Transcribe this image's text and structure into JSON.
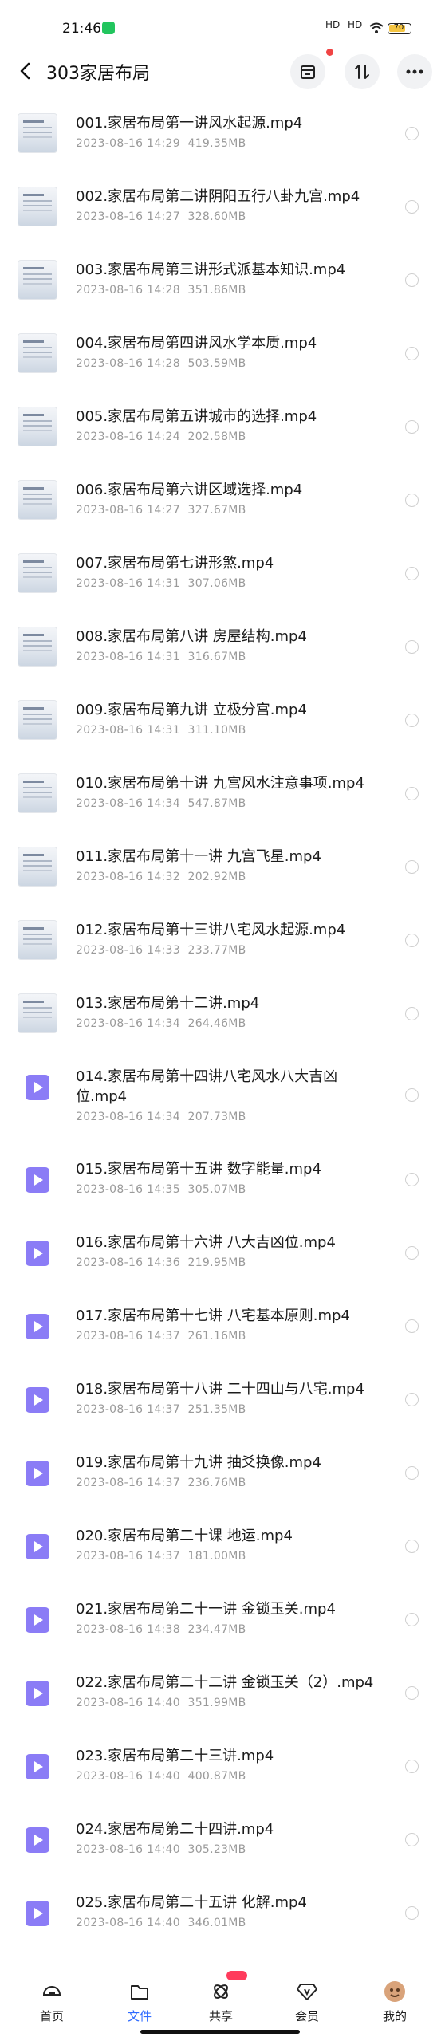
{
  "status_bar": {
    "time": "21:46",
    "signal1": "HD",
    "signal2": "HD",
    "battery": "70"
  },
  "header": {
    "title": "303家居布局"
  },
  "files": [
    {
      "name": "001.家居布局第一讲风水起源.mp4",
      "date": "2023-08-16 14:29",
      "size": "419.35MB",
      "thumb": "img"
    },
    {
      "name": "002.家居布局第二讲阴阳五行八卦九宫.mp4",
      "date": "2023-08-16 14:27",
      "size": "328.60MB",
      "thumb": "img"
    },
    {
      "name": "003.家居布局第三讲形式派基本知识.mp4",
      "date": "2023-08-16 14:28",
      "size": "351.86MB",
      "thumb": "img"
    },
    {
      "name": "004.家居布局第四讲风水学本质.mp4",
      "date": "2023-08-16 14:28",
      "size": "503.59MB",
      "thumb": "img"
    },
    {
      "name": "005.家居布局第五讲城市的选择.mp4",
      "date": "2023-08-16 14:24",
      "size": "202.58MB",
      "thumb": "img"
    },
    {
      "name": "006.家居布局第六讲区域选择.mp4",
      "date": "2023-08-16 14:27",
      "size": "327.67MB",
      "thumb": "img"
    },
    {
      "name": "007.家居布局第七讲形煞.mp4",
      "date": "2023-08-16 14:31",
      "size": "307.06MB",
      "thumb": "img"
    },
    {
      "name": "008.家居布局第八讲 房屋结构.mp4",
      "date": "2023-08-16 14:31",
      "size": "316.67MB",
      "thumb": "img"
    },
    {
      "name": "009.家居布局第九讲 立极分宫.mp4",
      "date": "2023-08-16 14:31",
      "size": "311.10MB",
      "thumb": "img"
    },
    {
      "name": "010.家居布局第十讲 九宫风水注意事项.mp4",
      "date": "2023-08-16 14:34",
      "size": "547.87MB",
      "thumb": "img"
    },
    {
      "name": "011.家居布局第十一讲 九宫飞星.mp4",
      "date": "2023-08-16 14:32",
      "size": "202.92MB",
      "thumb": "img"
    },
    {
      "name": "012.家居布局第十三讲八宅风水起源.mp4",
      "date": "2023-08-16 14:33",
      "size": "233.77MB",
      "thumb": "img"
    },
    {
      "name": "013.家居布局第十二讲.mp4",
      "date": "2023-08-16 14:34",
      "size": "264.46MB",
      "thumb": "img"
    },
    {
      "name": "014.家居布局第十四讲八宅风水八大吉凶位.mp4",
      "date": "2023-08-16 14:34",
      "size": "207.73MB",
      "thumb": "video"
    },
    {
      "name": "015.家居布局第十五讲 数字能量.mp4",
      "date": "2023-08-16 14:35",
      "size": "305.07MB",
      "thumb": "video"
    },
    {
      "name": "016.家居布局第十六讲 八大吉凶位.mp4",
      "date": "2023-08-16 14:36",
      "size": "219.95MB",
      "thumb": "video"
    },
    {
      "name": "017.家居布局第十七讲 八宅基本原则.mp4",
      "date": "2023-08-16 14:37",
      "size": "261.16MB",
      "thumb": "video"
    },
    {
      "name": "018.家居布局第十八讲 二十四山与八宅.mp4",
      "date": "2023-08-16 14:37",
      "size": "251.35MB",
      "thumb": "video"
    },
    {
      "name": "019.家居布局第十九讲 抽爻换像.mp4",
      "date": "2023-08-16 14:37",
      "size": "236.76MB",
      "thumb": "video"
    },
    {
      "name": "020.家居布局第二十课 地运.mp4",
      "date": "2023-08-16 14:37",
      "size": "181.00MB",
      "thumb": "video"
    },
    {
      "name": "021.家居布局第二十一讲 金锁玉关.mp4",
      "date": "2023-08-16 14:38",
      "size": "234.47MB",
      "thumb": "video"
    },
    {
      "name": "022.家居布局第二十二讲 金锁玉关（2）.mp4",
      "date": "2023-08-16 14:40",
      "size": "351.99MB",
      "thumb": "video"
    },
    {
      "name": "023.家居布局第二十三讲.mp4",
      "date": "2023-08-16 14:40",
      "size": "400.87MB",
      "thumb": "video"
    },
    {
      "name": "024.家居布局第二十四讲.mp4",
      "date": "2023-08-16 14:40",
      "size": "305.23MB",
      "thumb": "video"
    },
    {
      "name": "025.家居布局第二十五讲 化解.mp4",
      "date": "2023-08-16 14:40",
      "size": "346.01MB",
      "thumb": "video"
    }
  ],
  "tabs": [
    {
      "label": "首页",
      "icon": "home-icon"
    },
    {
      "label": "文件",
      "icon": "folder-icon",
      "active": true
    },
    {
      "label": "共享",
      "icon": "share-icon"
    },
    {
      "label": "会员",
      "icon": "vip-icon"
    },
    {
      "label": "我的",
      "icon": "avatar-icon"
    }
  ],
  "colors": {
    "accent": "#2f6bff",
    "video_icon": "#8b7cf6",
    "meta_text": "#9a9a9a"
  }
}
